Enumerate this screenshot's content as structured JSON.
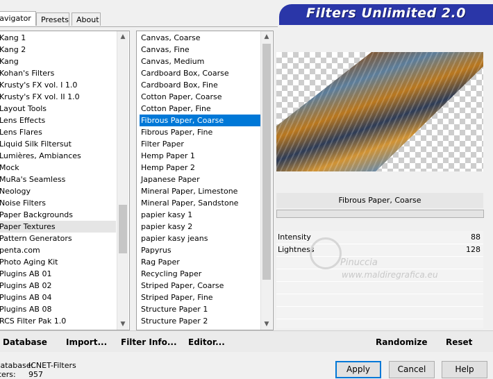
{
  "tabs": [
    {
      "label": "Navigator"
    },
    {
      "label": "Presets"
    },
    {
      "label": "About"
    }
  ],
  "banner": {
    "title": "Filters Unlimited 2.0"
  },
  "categories": {
    "items": [
      "Kang 1",
      "Kang 2",
      "Kang",
      "Kohan's Filters",
      "Krusty's FX vol. I 1.0",
      "Krusty's FX vol. II 1.0",
      "Layout Tools",
      "Lens Effects",
      "Lens Flares",
      "Liquid Silk Filtersut",
      "Lumières, Ambiances",
      "Mock",
      "MuRa's Seamless",
      "Neology",
      "Noise Filters",
      "Paper Backgrounds",
      "Paper Textures",
      "Pattern Generators",
      "penta.com",
      "Photo Aging Kit",
      "Plugins AB 01",
      "Plugins AB 02",
      "Plugins AB 04",
      "Plugins AB 08",
      "RCS Filter Pak 1.0"
    ],
    "highlighted_index": 16
  },
  "filters": {
    "items": [
      "Canvas, Coarse",
      "Canvas, Fine",
      "Canvas, Medium",
      "Cardboard Box, Coarse",
      "Cardboard Box, Fine",
      "Cotton Paper, Coarse",
      "Cotton Paper, Fine",
      "Fibrous Paper, Coarse",
      "Fibrous Paper, Fine",
      "Filter Paper",
      "Hemp Paper 1",
      "Hemp Paper 2",
      "Japanese Paper",
      "Mineral Paper, Limestone",
      "Mineral Paper, Sandstone",
      "papier kasy 1",
      "papier kasy 2",
      "papier kasy jeans",
      "Papyrus",
      "Rag Paper",
      "Recycling Paper",
      "Striped Paper, Coarse",
      "Striped Paper, Fine",
      "Structure Paper 1",
      "Structure Paper 2"
    ],
    "selected_index": 7
  },
  "preview": {
    "label": "Fibrous Paper, Coarse"
  },
  "params": [
    {
      "name": "Intensity",
      "value": "88"
    },
    {
      "name": "Lightness",
      "value": "128"
    }
  ],
  "watermark": {
    "name": "Pinuccia",
    "url": "www.maldiregrafica.eu"
  },
  "toolbar": {
    "database": "Database",
    "import": "Import...",
    "filter_info": "Filter Info...",
    "editor": "Editor...",
    "randomize": "Randomize",
    "reset": "Reset"
  },
  "info": {
    "database_label": "Database:",
    "database_value": "ICNET-Filters",
    "filters_label": "Filters:",
    "filters_value": "957"
  },
  "dialog": {
    "apply": "Apply",
    "cancel": "Cancel",
    "help": "Help"
  }
}
